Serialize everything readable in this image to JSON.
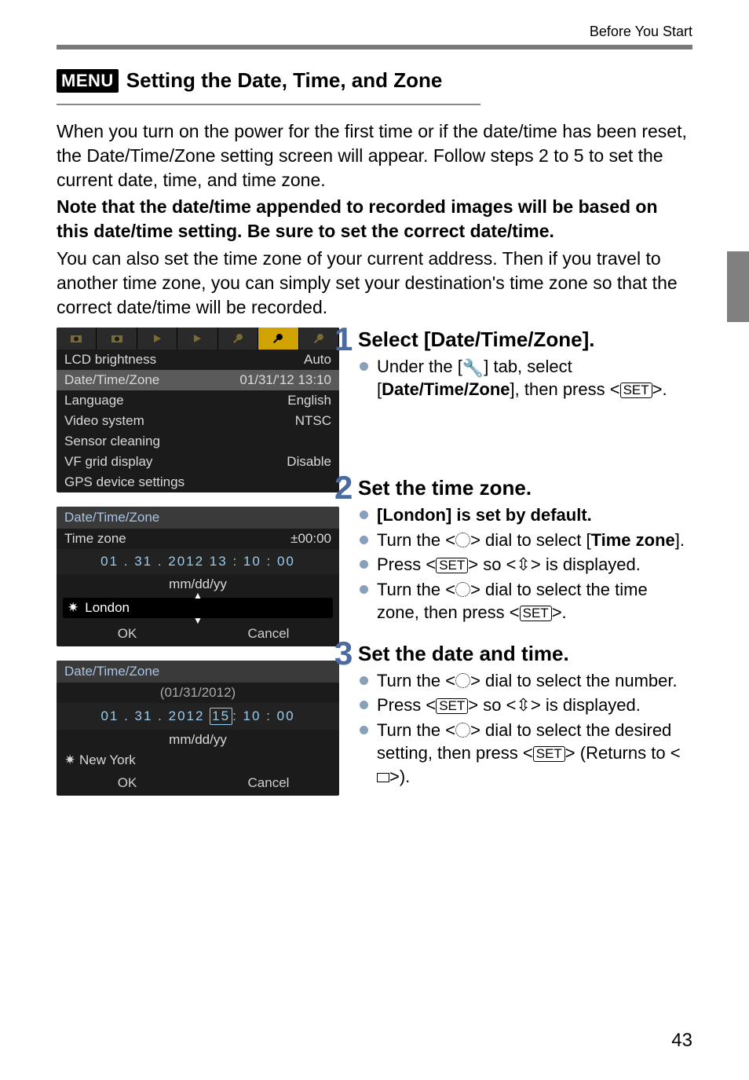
{
  "header": {
    "crumb": "Before You Start"
  },
  "section": {
    "badge": "MENU",
    "title": "Setting the Date, Time, and Zone"
  },
  "intro": {
    "p1": "When you turn on the power for the first time or if the date/time has been reset, the Date/Time/Zone setting screen will appear. Follow steps 2 to 5 to set the current date, time, and time zone.",
    "p2": "Note that the date/time appended to recorded images will be based on this date/time setting. Be sure to set the correct date/time.",
    "p3": "You can also set the time zone of your current address. Then if you travel to another time zone, you can simply set your destination's time zone so that the correct date/time will be recorded."
  },
  "panels": {
    "menu": {
      "rows": {
        "lcd": {
          "label": "LCD brightness",
          "value": "Auto"
        },
        "dtz": {
          "label": "Date/Time/Zone",
          "value": "01/31/'12 13:10"
        },
        "lang": {
          "label": "Language",
          "value": "English"
        },
        "video": {
          "label": "Video system",
          "value": "NTSC"
        },
        "sens": {
          "label": "Sensor cleaning",
          "value": ""
        },
        "vf": {
          "label": "VF grid display",
          "value": "Disable"
        },
        "gps": {
          "label": "GPS device settings",
          "value": ""
        }
      }
    },
    "tz": {
      "title": "Date/Time/Zone",
      "tzlabel": "Time zone",
      "tzoffset": "±00:00",
      "datetime": "01 . 31 . 2012    13 : 10 : 00",
      "format": "mm/dd/yy",
      "city": "London",
      "ok": "OK",
      "cancel": "Cancel"
    },
    "date": {
      "title": "Date/Time/Zone",
      "topdate": "(01/31/2012)",
      "line_pre": "01 . 31 . 2012   ",
      "line_sel": "15",
      "line_post": ": 10 : 00",
      "format": "mm/dd/yy",
      "city": "New York",
      "ok": "OK",
      "cancel": "Cancel"
    }
  },
  "steps": {
    "s1": {
      "num": "1",
      "title": "Select [Date/Time/Zone].",
      "b1_pre": "Under the [",
      "b1_post": "] tab, select [",
      "b1_bold": "Date/Time/Zone",
      "b1_tail": "], then press <",
      "b1_end": ">."
    },
    "s2": {
      "num": "2",
      "title": "Set the time zone.",
      "b1": "[London] is set by default.",
      "b2_pre": "Turn the <",
      "b2_mid": "> dial to select [",
      "b2_bold": "Time zone",
      "b2_end": "].",
      "b3_pre": "Press <",
      "b3_mid": "> so <",
      "b3_end": "> is displayed.",
      "b4_pre": "Turn the <",
      "b4_mid": "> dial to select the time zone, then press <",
      "b4_end": ">."
    },
    "s3": {
      "num": "3",
      "title": "Set the date and time.",
      "b1_pre": "Turn the <",
      "b1_end": "> dial to select the number.",
      "b2_pre": "Press <",
      "b2_mid": "> so <",
      "b2_end": "> is displayed.",
      "b3_pre": "Turn the <",
      "b3_mid": "> dial to select the desired setting, then press <",
      "b3_end": "> (Returns to <",
      "b3_fin": ">)."
    }
  },
  "glyphs": {
    "set": "SET",
    "updn": "⇳",
    "wrench": "🔧"
  },
  "footer": {
    "page": "43"
  }
}
